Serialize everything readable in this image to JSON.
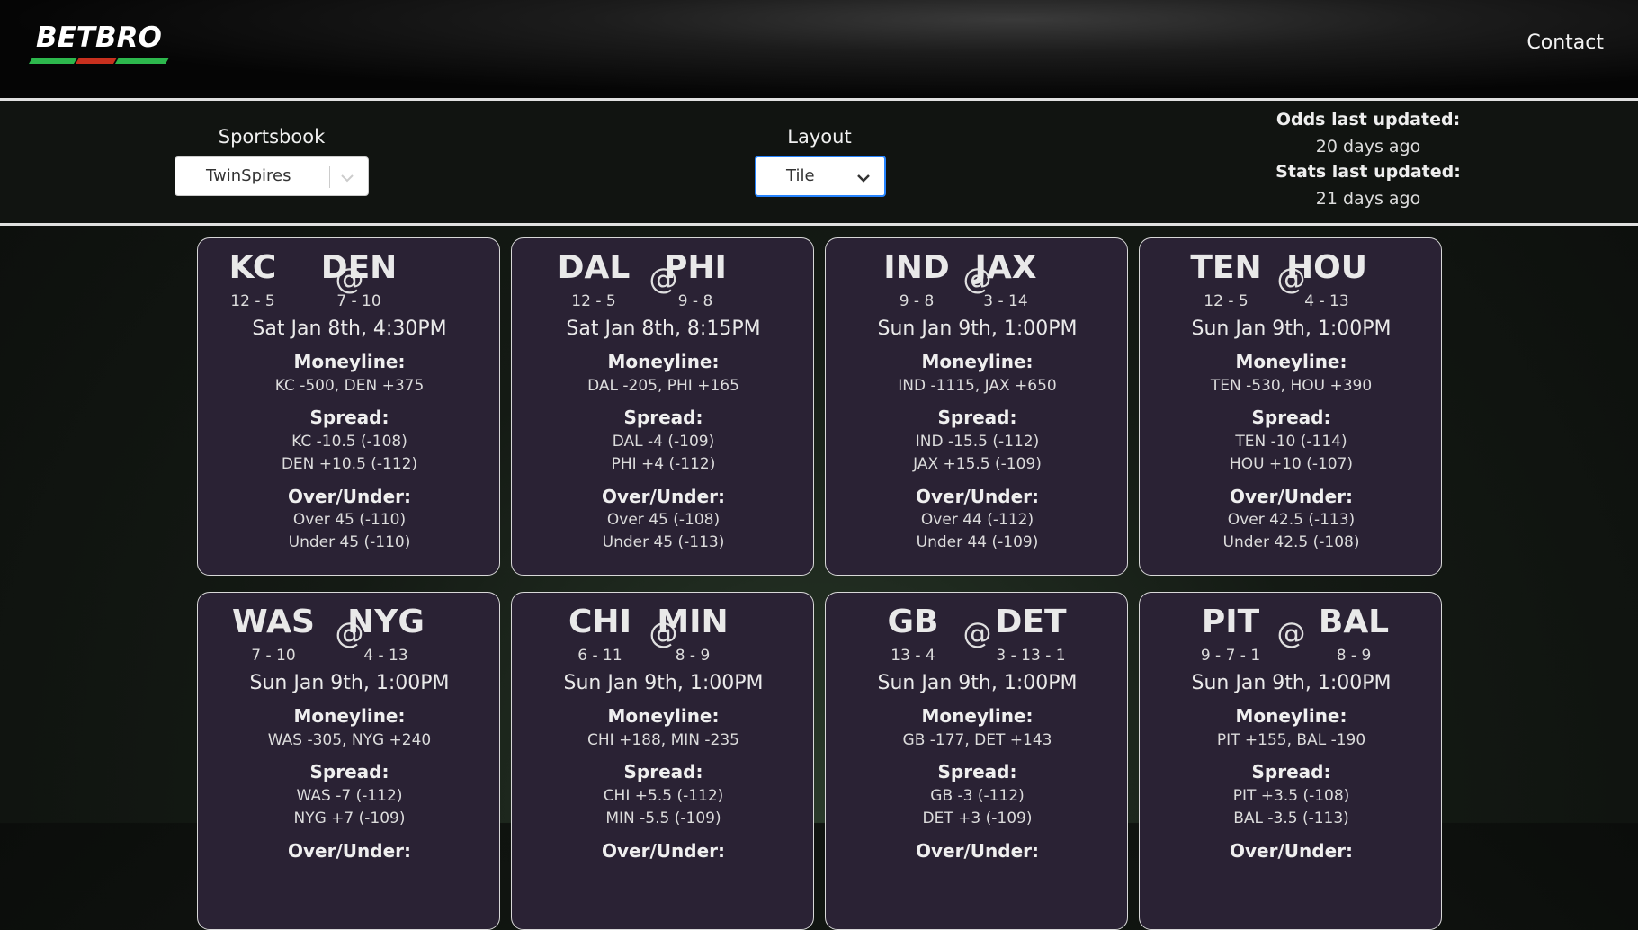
{
  "header": {
    "logo": "BETBRO",
    "contact_label": "Contact"
  },
  "controls": {
    "sportsbook": {
      "label": "Sportsbook",
      "value": "TwinSpires"
    },
    "layout": {
      "label": "Layout",
      "value": "Tile"
    },
    "odds_updated": {
      "label": "Odds last updated:",
      "value": "20 days ago"
    },
    "stats_updated": {
      "label": "Stats last updated:",
      "value": "21 days ago"
    }
  },
  "labels": {
    "at": "@",
    "moneyline": "Moneyline:",
    "spread": "Spread:",
    "over_under": "Over/Under:"
  },
  "colors": {
    "logo_green": "#2db84d",
    "logo_red": "#c8301e",
    "accent_focus": "#2684ff",
    "card_bg": "#2a2234"
  },
  "games": [
    {
      "away": "KC",
      "home": "DEN",
      "away_rec": "12 - 5",
      "home_rec": "7 - 10",
      "date": "Sat Jan 8th, 4:30PM",
      "moneyline": "KC -500, DEN +375",
      "spread_away": "KC -10.5 (-108)",
      "spread_home": "DEN +10.5 (-112)",
      "over": "Over 45 (-110)",
      "under": "Under 45 (-110)"
    },
    {
      "away": "DAL",
      "home": "PHI",
      "away_rec": "12 - 5",
      "home_rec": "9 - 8",
      "date": "Sat Jan 8th, 8:15PM",
      "moneyline": "DAL -205, PHI +165",
      "spread_away": "DAL -4 (-109)",
      "spread_home": "PHI +4 (-112)",
      "over": "Over 45 (-108)",
      "under": "Under 45 (-113)"
    },
    {
      "away": "IND",
      "home": "JAX",
      "away_rec": "9 - 8",
      "home_rec": "3 - 14",
      "date": "Sun Jan 9th, 1:00PM",
      "moneyline": "IND -1115, JAX +650",
      "spread_away": "IND -15.5 (-112)",
      "spread_home": "JAX +15.5 (-109)",
      "over": "Over 44 (-112)",
      "under": "Under 44 (-109)"
    },
    {
      "away": "TEN",
      "home": "HOU",
      "away_rec": "12 - 5",
      "home_rec": "4 - 13",
      "date": "Sun Jan 9th, 1:00PM",
      "moneyline": "TEN -530, HOU +390",
      "spread_away": "TEN -10 (-114)",
      "spread_home": "HOU +10 (-107)",
      "over": "Over 42.5 (-113)",
      "under": "Under 42.5 (-108)"
    },
    {
      "away": "WAS",
      "home": "NYG",
      "away_rec": "7 - 10",
      "home_rec": "4 - 13",
      "date": "Sun Jan 9th, 1:00PM",
      "moneyline": "WAS -305, NYG +240",
      "spread_away": "WAS -7 (-112)",
      "spread_home": "NYG +7 (-109)",
      "over": "",
      "under": ""
    },
    {
      "away": "CHI",
      "home": "MIN",
      "away_rec": "6 - 11",
      "home_rec": "8 - 9",
      "date": "Sun Jan 9th, 1:00PM",
      "moneyline": "CHI +188, MIN -235",
      "spread_away": "CHI +5.5 (-112)",
      "spread_home": "MIN -5.5 (-109)",
      "over": "",
      "under": ""
    },
    {
      "away": "GB",
      "home": "DET",
      "away_rec": "13 - 4",
      "home_rec": "3 - 13 - 1",
      "date": "Sun Jan 9th, 1:00PM",
      "moneyline": "GB -177, DET +143",
      "spread_away": "GB -3 (-112)",
      "spread_home": "DET +3 (-109)",
      "over": "",
      "under": ""
    },
    {
      "away": "PIT",
      "home": "BAL",
      "away_rec": "9 - 7 - 1",
      "home_rec": "8 - 9",
      "date": "Sun Jan 9th, 1:00PM",
      "moneyline": "PIT +155, BAL -190",
      "spread_away": "PIT +3.5 (-108)",
      "spread_home": "BAL -3.5 (-113)",
      "over": "",
      "under": ""
    }
  ]
}
